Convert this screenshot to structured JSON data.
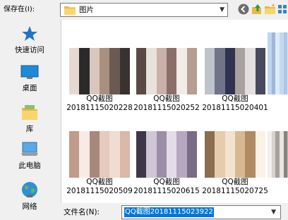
{
  "toolbar": {
    "save_in_label": "保存在(I):",
    "location": "图片",
    "icons": [
      "back-icon",
      "up-folder-icon",
      "new-folder-icon",
      "view-menu-icon"
    ]
  },
  "nav": {
    "items": [
      {
        "label": "快速访问",
        "icon": "star-icon"
      },
      {
        "label": "桌面",
        "icon": "desktop-icon"
      },
      {
        "label": "库",
        "icon": "library-icon"
      },
      {
        "label": "此电脑",
        "icon": "computer-icon"
      },
      {
        "label": "网络",
        "icon": "network-icon"
      }
    ]
  },
  "files": [
    {
      "line1": "QQ截图",
      "line2": "20181115020228"
    },
    {
      "line1": "QQ截图",
      "line2": "20181115020252"
    },
    {
      "line1": "QQ截图",
      "line2": "20181115020401"
    },
    {
      "line1": "",
      "line2": ""
    },
    {
      "line1": "QQ截图",
      "line2": "20181115020509"
    },
    {
      "line1": "QQ截图",
      "line2": "20181115020615"
    },
    {
      "line1": "QQ截图",
      "line2": "20181115020725"
    },
    {
      "line1": "",
      "line2": ""
    }
  ],
  "filename": {
    "label": "文件名(N):",
    "value": "QQ截图20181115023922"
  }
}
